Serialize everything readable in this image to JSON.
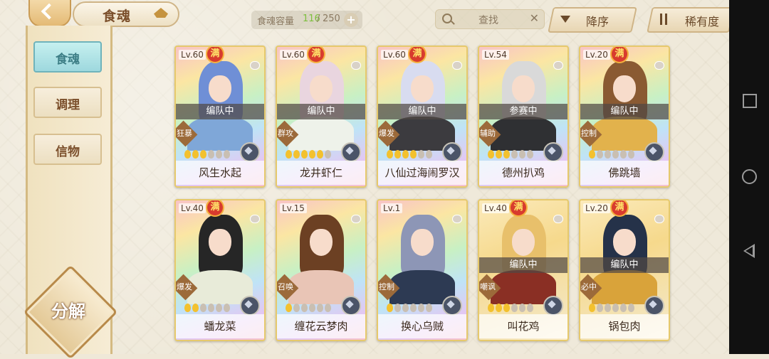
{
  "header": {
    "title": "食魂",
    "capacity_label": "食魂容量",
    "capacity_used": "116",
    "capacity_sep": "/",
    "capacity_total": "250",
    "search_placeholder": "查找",
    "sort_desc_label": "降序",
    "sort_rarity_label": "稀有度"
  },
  "sidebar": {
    "tabs": [
      {
        "label": "食魂"
      },
      {
        "label": "调理"
      },
      {
        "label": "信物"
      }
    ],
    "decompose_label": "分解"
  },
  "cards": [
    {
      "level": "Lv.60",
      "full": "满",
      "status": "编队中",
      "role": "狂暴",
      "name": "风生水起",
      "stars": 3,
      "frame": "rainbow",
      "hair": "#6f8fd6",
      "robe": "#7fa7d8"
    },
    {
      "level": "Lv.60",
      "full": "满",
      "status": "编队中",
      "role": "群攻",
      "name": "龙井虾仁",
      "stars": 5,
      "frame": "rainbow",
      "hair": "#e9d5df",
      "robe": "#eef2ea"
    },
    {
      "level": "Lv.60",
      "full": "满",
      "status": "编队中",
      "role": "爆发",
      "name": "八仙过海闹罗汉",
      "stars": 4,
      "frame": "rainbow",
      "hair": "#d8dcf0",
      "robe": "#3c3b3f"
    },
    {
      "level": "Lv.54",
      "full": "",
      "status": "参赛中",
      "role": "辅助",
      "name": "德州扒鸡",
      "stars": 3,
      "frame": "rainbow",
      "hair": "#d9d9d9",
      "robe": "#2f3033"
    },
    {
      "level": "Lv.20",
      "full": "满",
      "status": "编队中",
      "role": "控制",
      "name": "佛跳墙",
      "stars": 1,
      "frame": "rainbow",
      "hair": "#8a5a32",
      "robe": "#e2b24c"
    },
    {
      "level": "Lv.40",
      "full": "满",
      "status": "",
      "role": "爆发",
      "name": "蟠龙菜",
      "stars": 2,
      "frame": "rainbow",
      "hair": "#262626",
      "robe": "#e8ebd9"
    },
    {
      "level": "Lv.15",
      "full": "",
      "status": "",
      "role": "召唤",
      "name": "缠花云梦肉",
      "stars": 1,
      "frame": "rainbow",
      "hair": "#6c4023",
      "robe": "#e9c5b6"
    },
    {
      "level": "Lv.1",
      "full": "",
      "status": "",
      "role": "控制",
      "name": "换心乌贼",
      "stars": 1,
      "frame": "rainbow",
      "hair": "#8d96b6",
      "robe": "#2d3a53"
    },
    {
      "level": "Lv.40",
      "full": "满",
      "status": "编队中",
      "role": "嘲讽",
      "name": "叫花鸡",
      "stars": 3,
      "frame": "gold",
      "hair": "#e8c06b",
      "robe": "#8a2f24"
    },
    {
      "level": "Lv.20",
      "full": "满",
      "status": "编队中",
      "role": "必中",
      "name": "锅包肉",
      "stars": 1,
      "frame": "gold",
      "hair": "#253249",
      "robe": "#d9a33a"
    }
  ]
}
